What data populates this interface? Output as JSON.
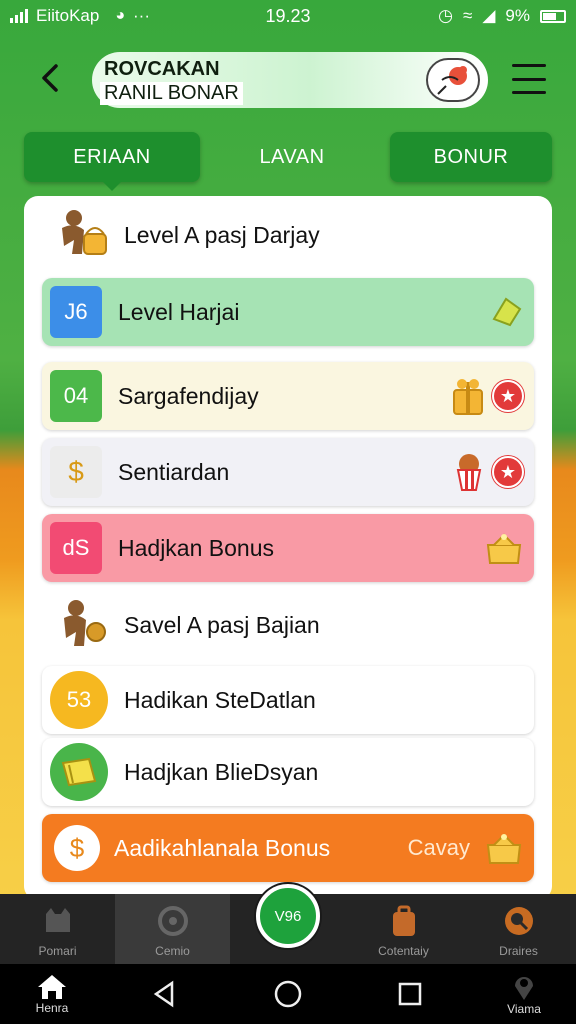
{
  "status": {
    "carrier": "EiitoKap",
    "time": "19.23",
    "battery": "9%"
  },
  "header": {
    "title_line1": "ROVCAKAN",
    "title_line2": "RANIL BONAR"
  },
  "tabs": [
    {
      "label": "ERIAAN",
      "state": "active"
    },
    {
      "label": "LAVAN",
      "state": "plain"
    },
    {
      "label": "BONUR",
      "state": "solid"
    }
  ],
  "list": {
    "section1": "Level A pasj Darjay",
    "rows": [
      {
        "badge": "J6",
        "label": "Level Harjai",
        "color": "#a6e3b4",
        "badge_color": "#3c8ee8"
      },
      {
        "badge": "04",
        "label": "Sargafendijay",
        "color": "#faf6e0",
        "badge_color": "#4cb84a"
      },
      {
        "badge": "$",
        "label": "Sentiardan",
        "color": "#f1f1f6",
        "badge_color": "#ececec"
      },
      {
        "badge": "dS",
        "label": "Hadjkan Bonus",
        "color": "#f99aa5",
        "badge_color": "#f24b73"
      }
    ],
    "section2": "Savel A pasj Bajian",
    "rows2": [
      {
        "badge": "53",
        "label": "Hadikan SteDatlan",
        "badge_color": "#f6b820"
      },
      {
        "badge": "",
        "label": "Hadjkan BlieDsyan",
        "badge_color": "#49b54a"
      }
    ],
    "bonus_row": {
      "label": "Aadikahlanala Bonus",
      "right_label": "Cavay",
      "badge": "$",
      "color": "#f47b20"
    }
  },
  "nav": [
    {
      "label": "Pomari",
      "icon": "cat-icon"
    },
    {
      "label": "Cemio",
      "icon": "gauge-icon"
    },
    {
      "label": "Cotentaiy",
      "icon": "backpack-icon"
    },
    {
      "label": "Draires",
      "icon": "magnifier-icon"
    }
  ],
  "fab": {
    "label": "V96"
  },
  "system": {
    "home_label": "Henra",
    "right_label": "Viama"
  }
}
